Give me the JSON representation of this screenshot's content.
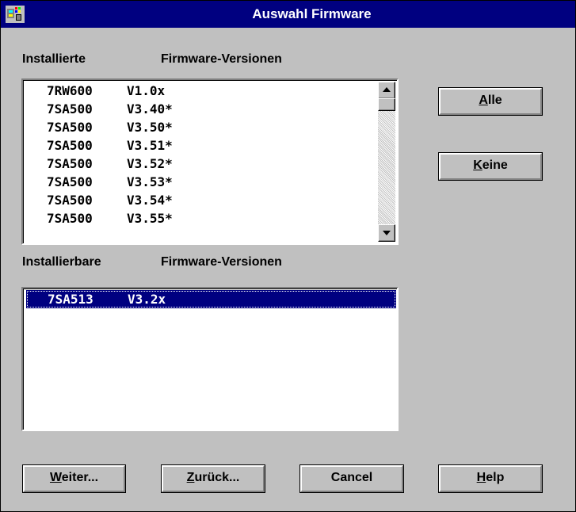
{
  "window": {
    "title": "Auswahl Firmware",
    "icon": "application-icon"
  },
  "installed": {
    "label_left": "Installierte",
    "label_right": "Firmware-Versionen",
    "items": [
      {
        "device": "7RW600",
        "version": "V1.0x"
      },
      {
        "device": "7SA500",
        "version": "V3.40*"
      },
      {
        "device": "7SA500",
        "version": "V3.50*"
      },
      {
        "device": "7SA500",
        "version": "V3.51*"
      },
      {
        "device": "7SA500",
        "version": "V3.52*"
      },
      {
        "device": "7SA500",
        "version": "V3.53*"
      },
      {
        "device": "7SA500",
        "version": "V3.54*"
      },
      {
        "device": "7SA500",
        "version": "V3.55*"
      }
    ]
  },
  "installable": {
    "label_left": "Installierbare",
    "label_right": "Firmware-Versionen",
    "items": [
      {
        "device": "7SA513",
        "version": "V3.2x",
        "selected": true
      }
    ]
  },
  "side_buttons": {
    "alle_mnemonic": "A",
    "alle_rest": "lle",
    "keine_mnemonic": "K",
    "keine_rest": "eine"
  },
  "bottom_buttons": {
    "weiter_mnemonic": "W",
    "weiter_rest": "eiter...",
    "zurueck_mnemonic": "Z",
    "zurueck_rest": "urück...",
    "cancel": "Cancel",
    "help_mnemonic": "H",
    "help_rest": "elp"
  },
  "colors": {
    "titlebar": "#000080",
    "dialog": "#c0c0c0",
    "selection": "#000080"
  }
}
